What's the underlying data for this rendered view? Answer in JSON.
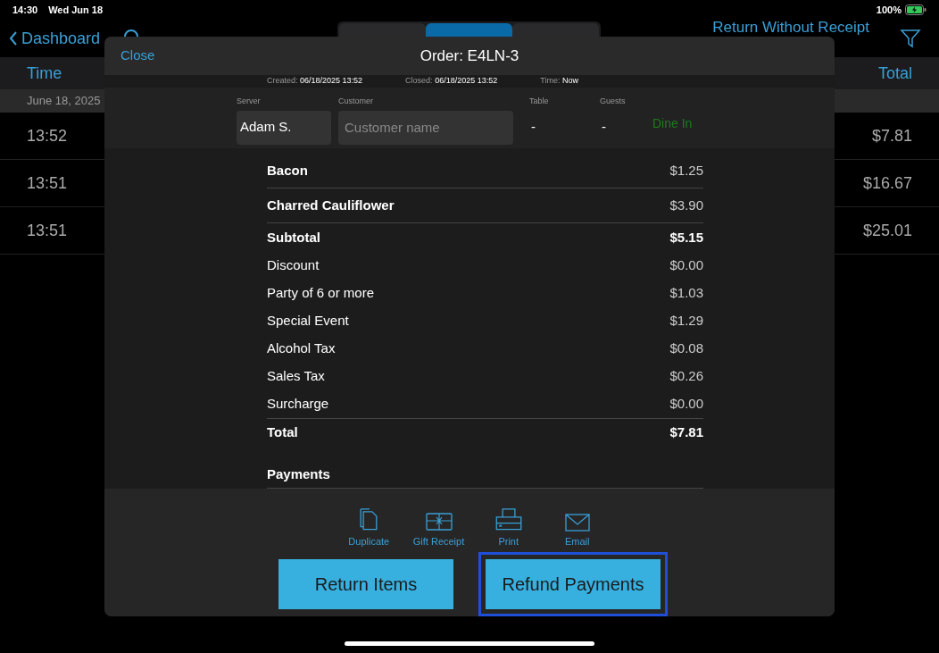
{
  "status_bar": {
    "time": "14:30",
    "date": "Wed Jun 18",
    "battery": "100%"
  },
  "nav": {
    "back": "Dashboard",
    "tabs": [
      {
        "selected": false
      },
      {
        "selected": true
      },
      {
        "selected": false
      }
    ],
    "action": "Return Without Receipt"
  },
  "table": {
    "columns": [
      "Time",
      "Total"
    ],
    "group": "June 18, 2025",
    "rows": [
      {
        "time": "13:52",
        "total": "$7.81"
      },
      {
        "time": "13:51",
        "total": "$16.67"
      },
      {
        "time": "13:51",
        "total": "$25.01"
      }
    ]
  },
  "modal": {
    "close": "Close",
    "title": "Order: E4LN-3",
    "meta": [
      {
        "label": "Created:",
        "value": "06/18/2025 13:52"
      },
      {
        "label": "Closed:",
        "value": "06/18/2025 13:52"
      },
      {
        "label": "Time:",
        "value": "Now"
      }
    ],
    "server": {
      "label": "Server",
      "value": "Adam S."
    },
    "customer": {
      "label": "Customer",
      "placeholder": "Customer name"
    },
    "table": {
      "label": "Table",
      "value": "-"
    },
    "guests": {
      "label": "Guests",
      "value": "-"
    },
    "order_type": "Dine In",
    "lines": [
      {
        "kind": "item",
        "label": "Bacon",
        "amount": "$1.25"
      },
      {
        "kind": "item",
        "label": "Charred Cauliflower",
        "amount": "$3.90"
      },
      {
        "kind": "subtotal",
        "label": "Subtotal",
        "amount": "$5.15"
      },
      {
        "kind": "charge",
        "label": "Discount",
        "amount": "$0.00"
      },
      {
        "kind": "charge",
        "label": "Party of 6 or more",
        "amount": "$1.03"
      },
      {
        "kind": "charge",
        "label": "Special Event",
        "amount": "$1.29"
      },
      {
        "kind": "charge",
        "label": "Alcohol Tax",
        "amount": "$0.08"
      },
      {
        "kind": "charge",
        "label": "Sales Tax",
        "amount": "$0.26"
      },
      {
        "kind": "charge",
        "label": "Surcharge",
        "amount": "$0.00"
      },
      {
        "kind": "total",
        "label": "Total",
        "amount": "$7.81"
      }
    ],
    "payments_heading": "Payments",
    "actions": [
      {
        "kind": "duplicate",
        "label": "Duplicate"
      },
      {
        "kind": "gift",
        "label": "Gift Receipt"
      },
      {
        "kind": "print",
        "label": "Print"
      },
      {
        "kind": "email",
        "label": "Email"
      }
    ],
    "buttons": [
      {
        "label": "Return Items",
        "highlighted": false
      },
      {
        "label": "Refund Payments",
        "highlighted": true
      }
    ]
  }
}
